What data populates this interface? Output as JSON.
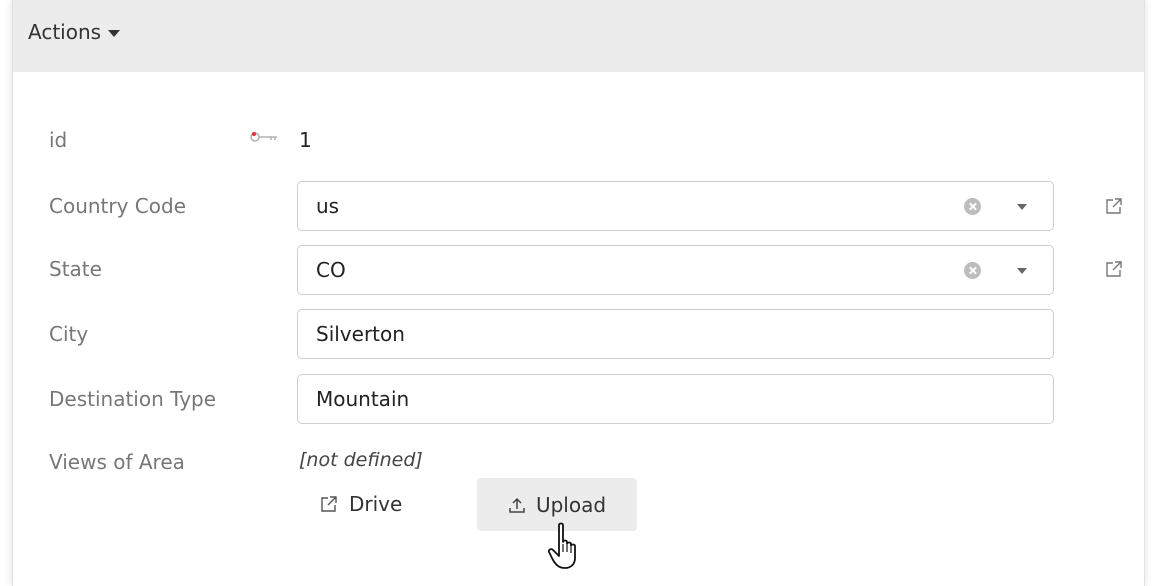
{
  "actions": {
    "label": "Actions"
  },
  "form": {
    "id": {
      "label": "id",
      "value": "1",
      "icon": "primary-key-icon"
    },
    "country_code": {
      "label": "Country Code",
      "value": "us"
    },
    "state": {
      "label": "State",
      "value": "CO"
    },
    "city": {
      "label": "City",
      "value": "Silverton"
    },
    "destination_type": {
      "label": "Destination Type",
      "value": "Mountain"
    },
    "views_of_area": {
      "label": "Views of Area",
      "value": "[not defined]",
      "drive_label": "Drive",
      "upload_label": "Upload"
    }
  },
  "colors": {
    "header_bg": "#ececec",
    "border": "#cfcfcf",
    "label": "#777777",
    "key_accent": "#e0323c"
  }
}
